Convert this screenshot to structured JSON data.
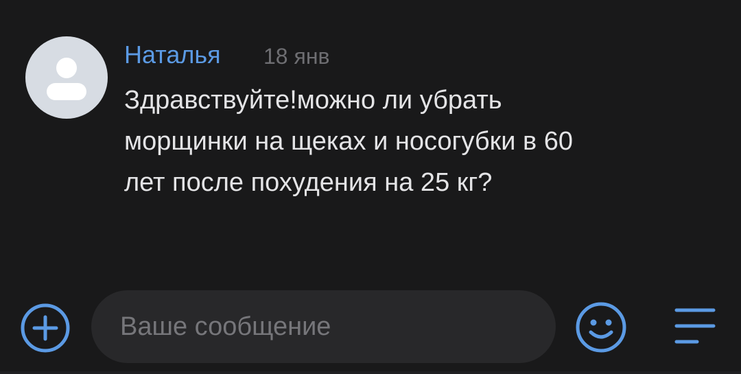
{
  "message": {
    "author": "Наталья",
    "timestamp": "18 янв",
    "text_lines": [
      "Здравствуйте!можно ли убрать",
      "морщинки на щеках и носогубки в 60",
      "лет после похудения на 25 кг?"
    ],
    "avatar_icon": "default-user-avatar-icon"
  },
  "composer": {
    "placeholder": "Ваше сообщение",
    "value": "",
    "add_icon": "plus-circle-icon",
    "emoji_icon": "smile-icon",
    "menu_icon": "menu-lines-icon"
  },
  "colors": {
    "background": "#19191a",
    "accent": "#5b9ae4",
    "text": "#e4e4e6",
    "muted": "#6e6e72",
    "input_bg": "#28282a",
    "avatar_bg": "#d7dce3"
  }
}
